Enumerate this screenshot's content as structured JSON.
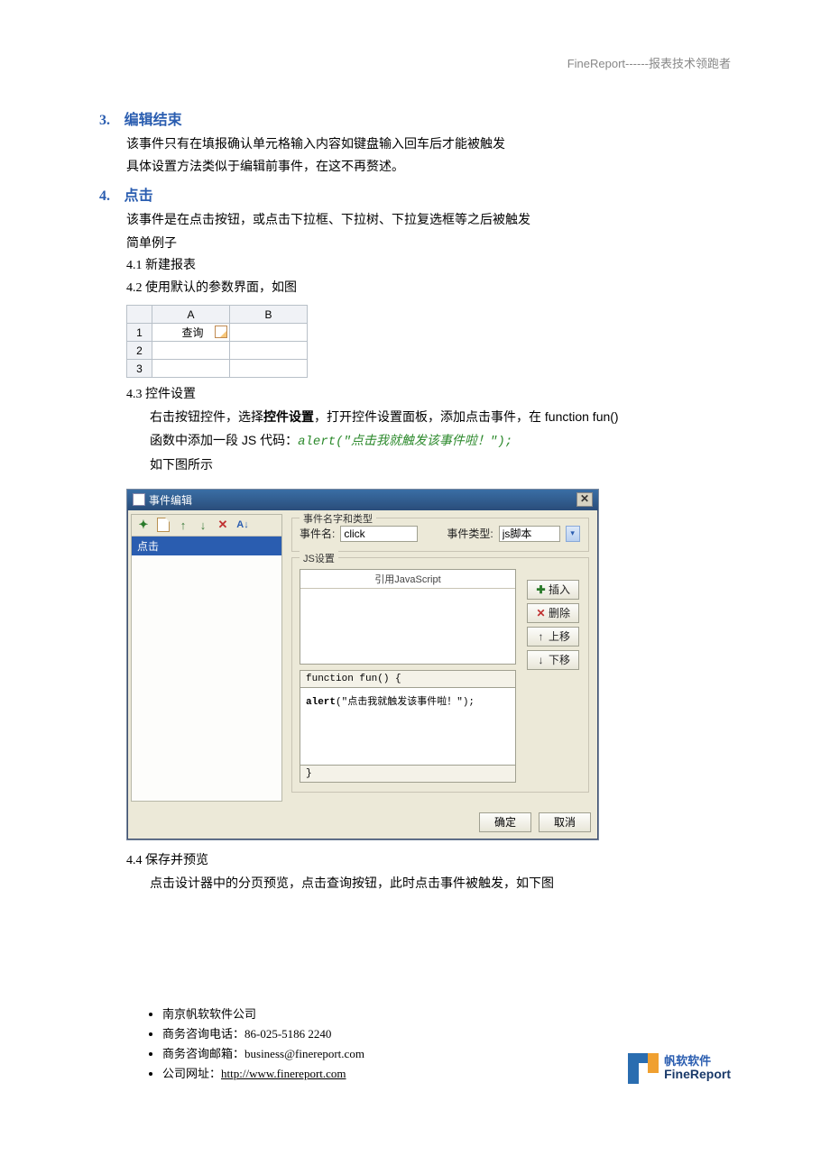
{
  "header": {
    "right": "FineReport------报表技术领跑者"
  },
  "section3": {
    "num": "3.",
    "title": "编辑结束",
    "line1": "该事件只有在填报确认单元格输入内容如键盘输入回车后才能被触发",
    "line2": "具体设置方法类似于编辑前事件，在这不再赘述。"
  },
  "section4": {
    "num": "4.",
    "title": "点击",
    "line1": "该事件是在点击按钮，或点击下拉框、下拉树、下拉复选框等之后被触发",
    "line2": "简单例子",
    "s41": "4.1 新建报表",
    "s42": "4.2 使用默认的参数界面，如图",
    "s43": "4.3 控件设置",
    "s43a_pre": "右击按钮控件，选择",
    "s43a_bold": "控件设置",
    "s43a_post": "，打开控件设置面板，添加点击事件，在 function fun()",
    "s43b_pre": "函数中添加一段 JS 代码：",
    "s43b_code": "alert(\"点击我就触发该事件啦！\");",
    "s43c": "如下图所示",
    "s44": "4.4 保存并预览",
    "s44a": "点击设计器中的分页预览，点击查询按钮，此时点击事件被触发，如下图"
  },
  "sheet": {
    "cols": {
      "A": "A",
      "B": "B"
    },
    "rows": {
      "1": "1",
      "2": "2",
      "3": "3"
    },
    "cellA1": "查询"
  },
  "dialog": {
    "title": "事件编辑",
    "list_item": "点击",
    "name_type_legend": "事件名字和类型",
    "name_lbl": "事件名:",
    "name_val": "click",
    "type_lbl": "事件类型:",
    "type_val": "js脚本",
    "js_legend": "JS设置",
    "js_header": "引用JavaScript",
    "btn_insert": "插入",
    "btn_delete": "删除",
    "btn_up": "上移",
    "btn_down": "下移",
    "func_open": "function fun() {",
    "code_line": "alert(\"点击我就触发该事件啦！\");",
    "func_close": "}",
    "ok": "确定",
    "cancel": "取消"
  },
  "footer": {
    "li1": "南京帆软软件公司",
    "li2_pre": "商务咨询电话：",
    "li2_val": "86-025-5186 2240",
    "li3_pre": "商务咨询邮箱：",
    "li3_val": "business@finereport.com",
    "li4_pre": "公司网址：",
    "li4_url": "http://www.finereport.com",
    "logo_zh": "帆软软件",
    "logo_en": "FineReport"
  }
}
